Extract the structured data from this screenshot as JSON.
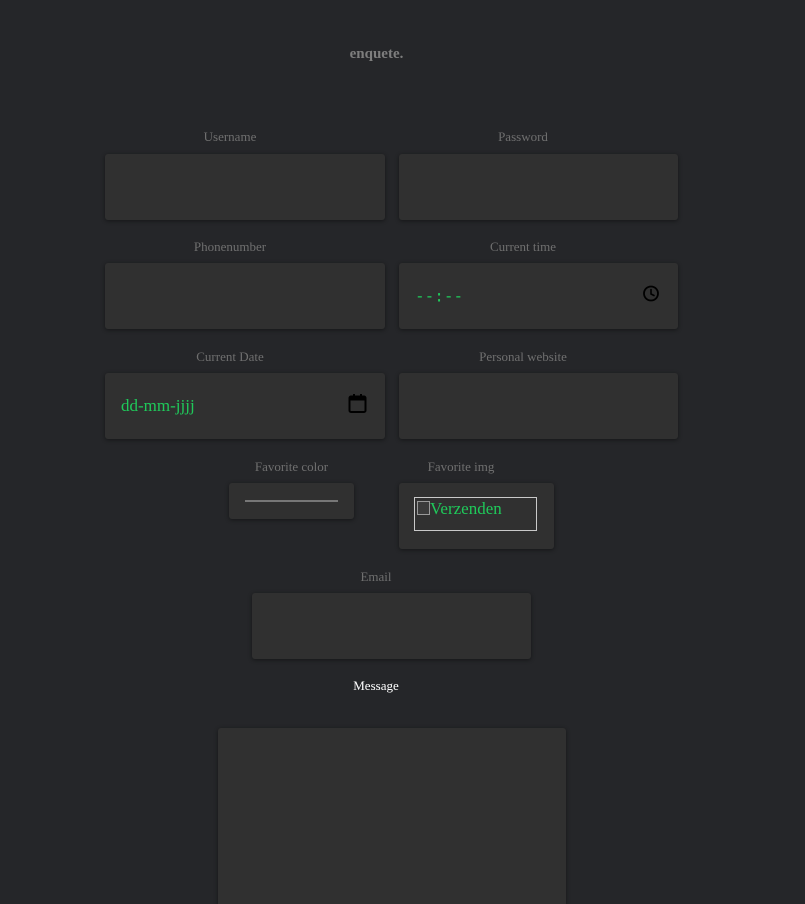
{
  "form": {
    "title": "enquete.",
    "fields": {
      "username": {
        "label": "Username",
        "value": ""
      },
      "password": {
        "label": "Password",
        "value": ""
      },
      "phone": {
        "label": "Phonenumber",
        "value": ""
      },
      "time": {
        "label": "Current time",
        "placeholder": "--:--"
      },
      "date": {
        "label": "Current Date",
        "placeholder": "dd-mm-jjjj"
      },
      "website": {
        "label": "Personal website",
        "value": ""
      },
      "color": {
        "label": "Favorite color"
      },
      "img": {
        "label": "Favorite img",
        "alt_text": "Verzenden"
      },
      "email": {
        "label": "Email",
        "value": ""
      },
      "message": {
        "label": "Message",
        "value": ""
      }
    }
  },
  "colors": {
    "background": "#252629",
    "field": "#303030",
    "label": "#6f6f6f",
    "accent_green": "#1fc95a"
  },
  "icons": {
    "time": "clock-icon",
    "date": "calendar-icon"
  }
}
